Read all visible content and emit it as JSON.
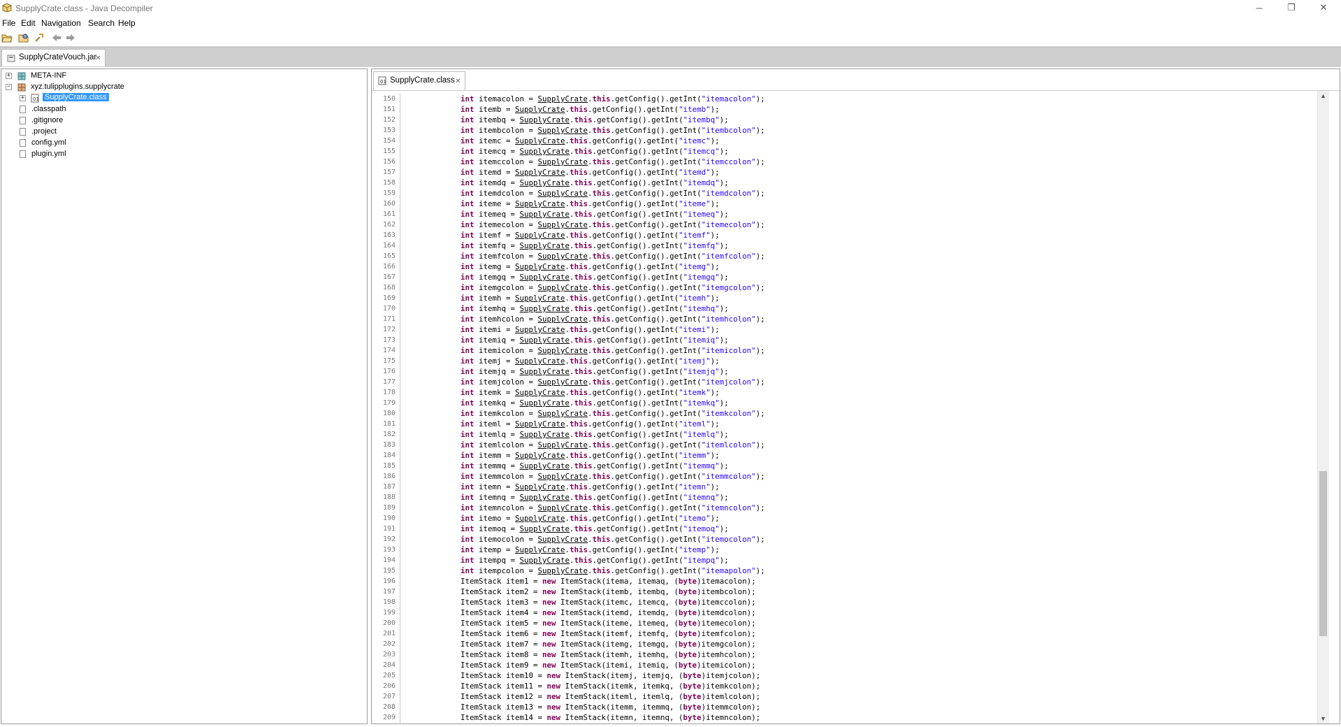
{
  "window": {
    "title": "SupplyCrate.class - Java Decompiler",
    "icons": {
      "app": "jd-app-icon",
      "minimize": "minimize-icon",
      "restore": "restore-icon",
      "close": "close-icon"
    }
  },
  "menu": [
    "File",
    "Edit",
    "Navigation",
    "Search",
    "Help"
  ],
  "toolbar": {
    "buttons": [
      "open-file-icon",
      "open-type-icon",
      "search-icon",
      "back-arrow-icon",
      "forward-arrow-icon"
    ]
  },
  "archive_tab": {
    "label": "SupplyCrateVouch.jar",
    "close": "✕"
  },
  "tree": {
    "items": [
      {
        "label": "META-INF",
        "expander": "+",
        "icon": "package-icon"
      },
      {
        "label": "xyz.tulipplugins.supplycrate",
        "expander": "−",
        "icon": "package-icon"
      },
      {
        "label": "SupplyCrate.class",
        "expander": "+",
        "icon": "class-file-icon",
        "selected": true
      },
      {
        "label": ".classpath",
        "icon": "file-icon"
      },
      {
        "label": ".gitignore",
        "icon": "file-icon"
      },
      {
        "label": ".project",
        "icon": "file-icon"
      },
      {
        "label": "config.yml",
        "icon": "file-icon"
      },
      {
        "label": "plugin.yml",
        "icon": "file-icon"
      }
    ]
  },
  "editor_tab": {
    "label": "SupplyCrate.class",
    "close": "✕"
  },
  "code": {
    "first_line": 150,
    "lines": [
      "int itemacolon = SupplyCrate.this.getConfig().getInt(\"itemacolon\");",
      "int itemb = SupplyCrate.this.getConfig().getInt(\"itemb\");",
      "int itembq = SupplyCrate.this.getConfig().getInt(\"itembq\");",
      "int itembcolon = SupplyCrate.this.getConfig().getInt(\"itembcolon\");",
      "int itemc = SupplyCrate.this.getConfig().getInt(\"itemc\");",
      "int itemcq = SupplyCrate.this.getConfig().getInt(\"itemcq\");",
      "int itemccolon = SupplyCrate.this.getConfig().getInt(\"itemccolon\");",
      "int itemd = SupplyCrate.this.getConfig().getInt(\"itemd\");",
      "int itemdq = SupplyCrate.this.getConfig().getInt(\"itemdq\");",
      "int itemdcolon = SupplyCrate.this.getConfig().getInt(\"itemdcolon\");",
      "int iteme = SupplyCrate.this.getConfig().getInt(\"iteme\");",
      "int itemeq = SupplyCrate.this.getConfig().getInt(\"itemeq\");",
      "int itemecolon = SupplyCrate.this.getConfig().getInt(\"itemecolon\");",
      "int itemf = SupplyCrate.this.getConfig().getInt(\"itemf\");",
      "int itemfq = SupplyCrate.this.getConfig().getInt(\"itemfq\");",
      "int itemfcolon = SupplyCrate.this.getConfig().getInt(\"itemfcolon\");",
      "int itemg = SupplyCrate.this.getConfig().getInt(\"itemg\");",
      "int itemgq = SupplyCrate.this.getConfig().getInt(\"itemgq\");",
      "int itemgcolon = SupplyCrate.this.getConfig().getInt(\"itemgcolon\");",
      "int itemh = SupplyCrate.this.getConfig().getInt(\"itemh\");",
      "int itemhq = SupplyCrate.this.getConfig().getInt(\"itemhq\");",
      "int itemhcolon = SupplyCrate.this.getConfig().getInt(\"itemhcolon\");",
      "int itemi = SupplyCrate.this.getConfig().getInt(\"itemi\");",
      "int itemiq = SupplyCrate.this.getConfig().getInt(\"itemiq\");",
      "int itemicolon = SupplyCrate.this.getConfig().getInt(\"itemicolon\");",
      "int itemj = SupplyCrate.this.getConfig().getInt(\"itemj\");",
      "int itemjq = SupplyCrate.this.getConfig().getInt(\"itemjq\");",
      "int itemjcolon = SupplyCrate.this.getConfig().getInt(\"itemjcolon\");",
      "int itemk = SupplyCrate.this.getConfig().getInt(\"itemk\");",
      "int itemkq = SupplyCrate.this.getConfig().getInt(\"itemkq\");",
      "int itemkcolon = SupplyCrate.this.getConfig().getInt(\"itemkcolon\");",
      "int iteml = SupplyCrate.this.getConfig().getInt(\"iteml\");",
      "int itemlq = SupplyCrate.this.getConfig().getInt(\"itemlq\");",
      "int itemlcolon = SupplyCrate.this.getConfig().getInt(\"itemlcolon\");",
      "int itemm = SupplyCrate.this.getConfig().getInt(\"itemm\");",
      "int itemmq = SupplyCrate.this.getConfig().getInt(\"itemmq\");",
      "int itemmcolon = SupplyCrate.this.getConfig().getInt(\"itemmcolon\");",
      "int itemn = SupplyCrate.this.getConfig().getInt(\"itemn\");",
      "int itemnq = SupplyCrate.this.getConfig().getInt(\"itemnq\");",
      "int itemncolon = SupplyCrate.this.getConfig().getInt(\"itemncolon\");",
      "int itemo = SupplyCrate.this.getConfig().getInt(\"itemo\");",
      "int itemoq = SupplyCrate.this.getConfig().getInt(\"itemoq\");",
      "int itemocolon = SupplyCrate.this.getConfig().getInt(\"itemocolon\");",
      "int itemp = SupplyCrate.this.getConfig().getInt(\"itemp\");",
      "int itempq = SupplyCrate.this.getConfig().getInt(\"itempq\");",
      "int itempcolon = SupplyCrate.this.getConfig().getInt(\"itemapolon\");",
      "ItemStack item1 = new ItemStack(itema, itemaq, (byte)itemacolon);",
      "ItemStack item2 = new ItemStack(itemb, itembq, (byte)itembcolon);",
      "ItemStack item3 = new ItemStack(itemc, itemcq, (byte)itemccolon);",
      "ItemStack item4 = new ItemStack(itemd, itemdq, (byte)itemdcolon);",
      "ItemStack item5 = new ItemStack(iteme, itemeq, (byte)itemecolon);",
      "ItemStack item6 = new ItemStack(itemf, itemfq, (byte)itemfcolon);",
      "ItemStack item7 = new ItemStack(itemg, itemgq, (byte)itemgcolon);",
      "ItemStack item8 = new ItemStack(itemh, itemhq, (byte)itemhcolon);",
      "ItemStack item9 = new ItemStack(itemi, itemiq, (byte)itemicolon);",
      "ItemStack item10 = new ItemStack(itemj, itemjq, (byte)itemjcolon);",
      "ItemStack item11 = new ItemStack(itemk, itemkq, (byte)itemkcolon);",
      "ItemStack item12 = new ItemStack(iteml, itemlq, (byte)itemlcolon);",
      "ItemStack item13 = new ItemStack(itemm, itemmq, (byte)itemmcolon);",
      "ItemStack item14 = new ItemStack(itemn, itemnq, (byte)itemncolon);"
    ]
  },
  "scrollbar": {
    "position_fraction": 0.74,
    "visible_fraction": 0.27
  },
  "colors": {
    "keyword": "#7f0055",
    "string": "#2a00ff",
    "selection": "#3399ff"
  }
}
